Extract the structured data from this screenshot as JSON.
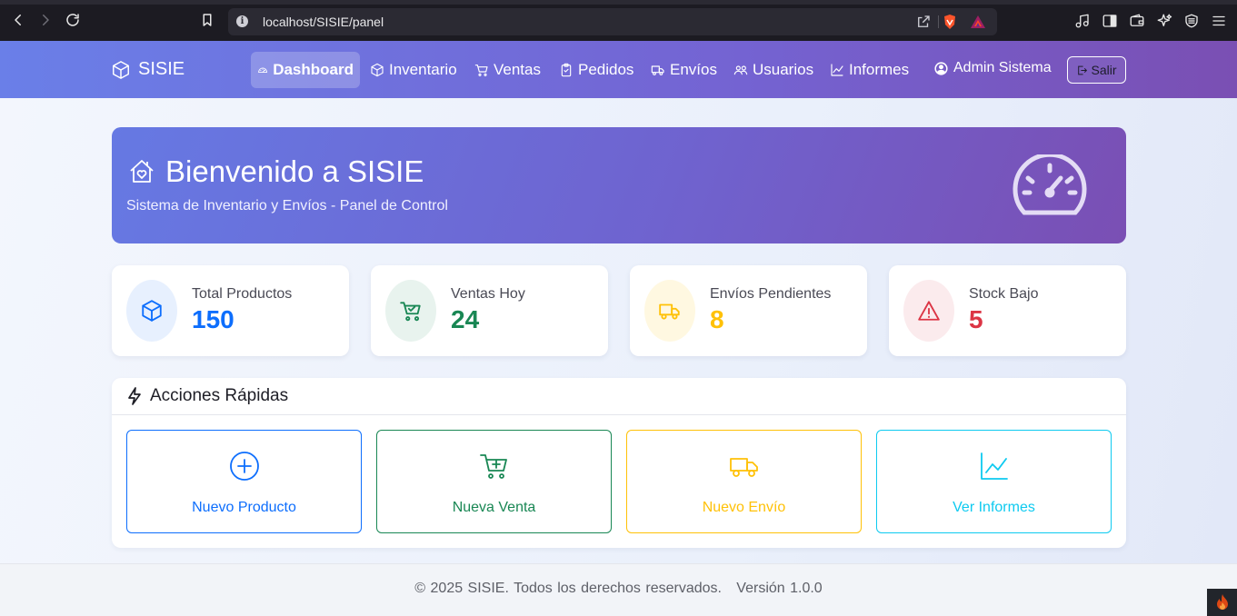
{
  "browser": {
    "url": "localhost/SISIE/panel"
  },
  "nav": {
    "brand": "SISIE",
    "items": [
      {
        "label": "Dashboard",
        "icon": "gauge-icon",
        "active": true
      },
      {
        "label": "Inventario",
        "icon": "box-icon"
      },
      {
        "label": "Ventas",
        "icon": "cart-icon"
      },
      {
        "label": "Pedidos",
        "icon": "clipboard-icon"
      },
      {
        "label": "Envíos",
        "icon": "truck-icon"
      },
      {
        "label": "Usuarios",
        "icon": "people-icon"
      },
      {
        "label": "Informes",
        "icon": "chart-icon"
      }
    ],
    "user": "Admin Sistema",
    "logout": "Salir"
  },
  "hero": {
    "title": "Bienvenido a SISIE",
    "subtitle": "Sistema de Inventario y Envíos - Panel de Control"
  },
  "stats": [
    {
      "label": "Total Productos",
      "value": "150",
      "color": "#0d6efd",
      "bg": "#e7f0fe",
      "icon": "box-icon"
    },
    {
      "label": "Ventas Hoy",
      "value": "24",
      "color": "#198754",
      "bg": "#e8f3ee",
      "icon": "cart-check-icon"
    },
    {
      "label": "Envíos Pendientes",
      "value": "8",
      "color": "#ffc107",
      "bg": "#fff8e1",
      "icon": "truck-icon"
    },
    {
      "label": "Stock Bajo",
      "value": "5",
      "color": "#dc3545",
      "bg": "#fbebed",
      "icon": "warning-icon"
    }
  ],
  "quick_actions": {
    "title": "Acciones Rápidas",
    "buttons": [
      {
        "label": "Nuevo Producto",
        "color": "#0d6efd",
        "icon": "plus-circle-icon"
      },
      {
        "label": "Nueva Venta",
        "color": "#198754",
        "icon": "cart-plus-icon"
      },
      {
        "label": "Nuevo Envío",
        "color": "#ffc107",
        "icon": "truck-icon"
      },
      {
        "label": "Ver Informes",
        "color": "#0dcaf0",
        "icon": "chart-icon"
      }
    ]
  },
  "footer": {
    "text": "© 2025 SISIE. Todos los derechos reservados.   Versión 1.0.0"
  }
}
